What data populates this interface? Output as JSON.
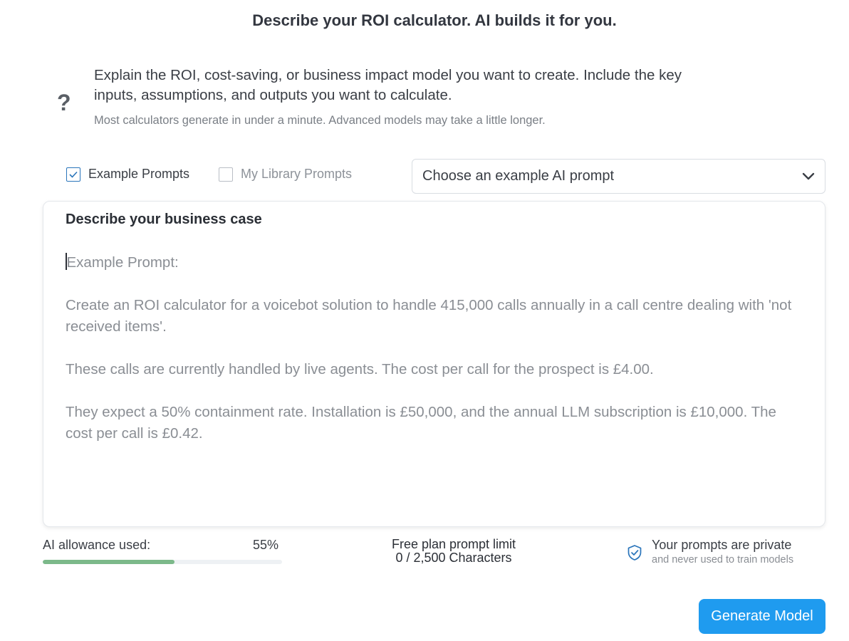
{
  "header": {
    "title": "Describe your ROI calculator. AI builds it for you."
  },
  "intro": {
    "icon": "question-mark-icon",
    "main": "Explain the ROI, cost-saving, or business impact model you want to create. Include the key inputs, assumptions, and outputs you want to calculate.",
    "sub": "Most calculators generate in under a minute. Advanced models may take a little longer."
  },
  "prompt_source": {
    "example": {
      "label": "Example Prompts",
      "checked": true
    },
    "library": {
      "label": "My Library Prompts",
      "checked": false
    }
  },
  "example_select": {
    "value": "Choose an example AI prompt"
  },
  "case": {
    "title": "Describe your business case",
    "paragraphs": [
      "Example Prompt:",
      "Create an ROI calculator for a voicebot solution to handle 415,000 calls annually in a call centre dealing with 'not received items'.",
      "These calls are currently handled by live agents. The cost per call for the prospect is £4.00.",
      "They expect a 50% containment rate. Installation is £50,000, and the annual LLM subscription is £10,000. The cost per call is £0.42."
    ]
  },
  "allowance": {
    "label": "AI allowance used:",
    "value_text": "55%",
    "fraction": 0.55,
    "bar_color": "#7cb98a"
  },
  "limit": {
    "title": "Free plan prompt limit",
    "count": "0 / 2,500 Characters"
  },
  "privacy": {
    "title": "Your prompts are private",
    "sub": "and never used to train models"
  },
  "actions": {
    "generate_label": "Generate Model",
    "accent": "#1f9bef"
  }
}
